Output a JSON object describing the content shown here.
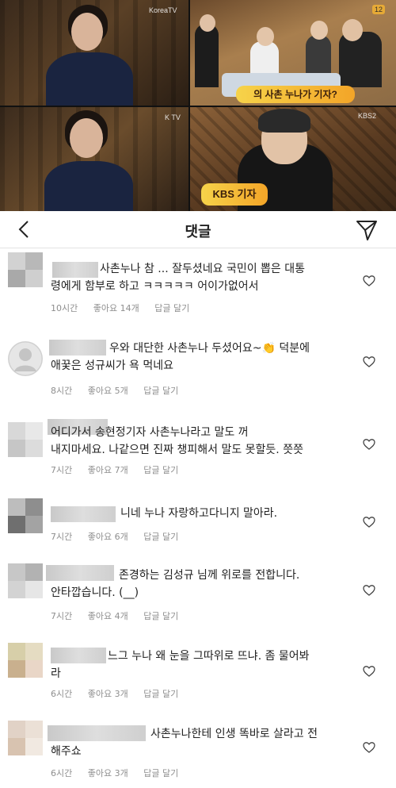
{
  "tv": {
    "logo_top_left": "KoreaTV",
    "logo_mid_left": "K TV",
    "caption_top_right": "의 사촌 누나가 기자?",
    "caption_bottom_right": "KBS 기자",
    "badge_bottom_right": "KBS2",
    "badge_top_right": "12"
  },
  "header": {
    "title": "댓글",
    "back_icon": "chevron-left-icon",
    "share_icon": "send-icon"
  },
  "comments": [
    {
      "line1": "사촌누나 참 ... 잘두셨네요  국민이 뽑은 대통",
      "line2": "령에게 함부로 하고 ㅋㅋㅋㅋㅋ 어이가없어서",
      "time": "10시간",
      "likes": "좋아요 14개",
      "reply": "답글 달기"
    },
    {
      "line1": "우와 대단한 사촌누나 두셨어요~👏 덕분에",
      "line2": "애꿎은 성규씨가 욕 먹네요",
      "time": "8시간",
      "likes": "좋아요 5개",
      "reply": "답글 달기"
    },
    {
      "line1": "어디가서 송현정기자 사촌누나라고 말도 꺼",
      "line2": "내지마세요. 나같으면 진짜 챙피해서 말도 못할듯. 쯧쯧",
      "time": "7시간",
      "likes": "좋아요 7개",
      "reply": "답글 달기"
    },
    {
      "line1": "니네 누나 자랑하고다니지 말아라.",
      "line2": "",
      "time": "7시간",
      "likes": "좋아요 6개",
      "reply": "답글 달기"
    },
    {
      "line1": "존경하는 김성규 님께 위로를 전합니다.",
      "line2": "안타깝습니다. (__)",
      "time": "7시간",
      "likes": "좋아요 4개",
      "reply": "답글 달기"
    },
    {
      "line1": "느그 누나 왜 눈을 그따위로 뜨냐. 좀 물어봐",
      "line2": "라",
      "time": "6시간",
      "likes": "좋아요 3개",
      "reply": "답글 달기"
    },
    {
      "line1": "사촌누나한테 인생 똑바로 살라고 전",
      "line2": "해주쇼",
      "time": "6시간",
      "likes": "좋아요 3개",
      "reply": "답글 달기"
    }
  ],
  "icons": {
    "heart": "heart-outline-icon"
  }
}
